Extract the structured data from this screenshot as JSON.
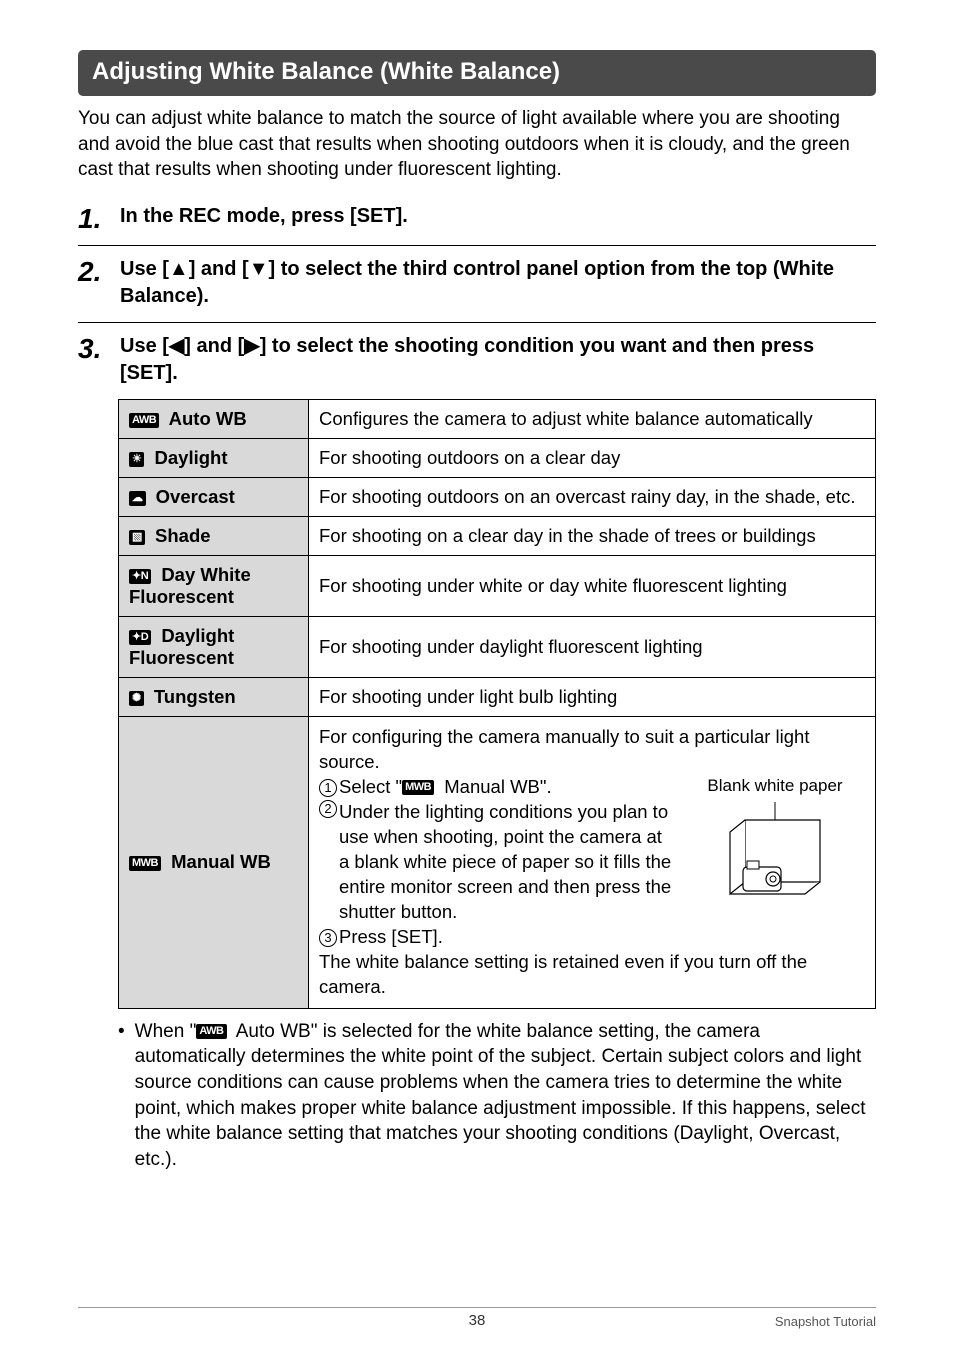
{
  "section_title": "Adjusting White Balance (White Balance)",
  "intro": "You can adjust white balance to match the source of light available where you are shooting and avoid the blue cast that results when shooting outdoors when it is cloudy, and the green cast that results when shooting under fluorescent lighting.",
  "steps": {
    "s1": {
      "num": "1",
      "text": "In the REC mode, press [SET]."
    },
    "s2": {
      "num": "2",
      "pre": "Use [",
      "mid": "] and [",
      "post": "] to select the third control panel option from the top (White Balance)."
    },
    "s3": {
      "num": "3",
      "pre": "Use [",
      "mid": "] and [",
      "post": "] to select the shooting condition you want and then press [SET]."
    }
  },
  "arrows": {
    "up": "▲",
    "down": "▼",
    "left": "◀",
    "right": "▶"
  },
  "tbl": {
    "auto": {
      "icon": "AWB",
      "label": "Auto WB",
      "desc": "Configures the camera to adjust white balance automatically"
    },
    "day": {
      "icon": "☀",
      "label": "Daylight",
      "desc": "For shooting outdoors on a clear day"
    },
    "over": {
      "icon": "☁",
      "label": "Overcast",
      "desc": "For shooting outdoors on an overcast rainy day, in the shade, etc."
    },
    "shade": {
      "icon": "▧",
      "label": "Shade",
      "desc": "For shooting on a clear day in the shade of trees or buildings"
    },
    "daywf": {
      "icon": "✦N",
      "label": "Day White Fluorescent",
      "desc": "For shooting under white or day white fluorescent lighting"
    },
    "dayf": {
      "icon": "✦D",
      "label": "Daylight Fluorescent",
      "desc": "For shooting under daylight fluorescent lighting"
    },
    "tung": {
      "icon": "✺",
      "label": "Tungsten",
      "desc": "For shooting under light bulb lighting"
    },
    "manual": {
      "icon": "MWB",
      "label": "Manual WB",
      "line1": "For configuring the camera manually to suit a particular light source.",
      "c1a": "Select \"",
      "c1icon": "MWB",
      "c1b": " Manual WB\".",
      "c2": "Under the lighting conditions you plan to use when shooting, point the camera at a blank white piece of paper so it fills the entire monitor screen and then press the shutter button.",
      "c3": "Press [SET].",
      "line2": "The white balance setting is retained even if you turn off the camera.",
      "caption": "Blank white paper"
    }
  },
  "circled": {
    "one": "1",
    "two": "2",
    "three": "3"
  },
  "note": {
    "pre": "When \"",
    "icon": "AWB",
    "post": " Auto WB\" is selected for the white balance setting, the camera automatically determines the white point of the subject. Certain subject colors and light source conditions can cause problems when the camera tries to determine the white point, which makes proper white balance adjustment impossible. If this happens, select the white balance setting that matches your shooting conditions (Daylight, Overcast, etc.)."
  },
  "footer": {
    "page": "38",
    "section": "Snapshot Tutorial"
  }
}
